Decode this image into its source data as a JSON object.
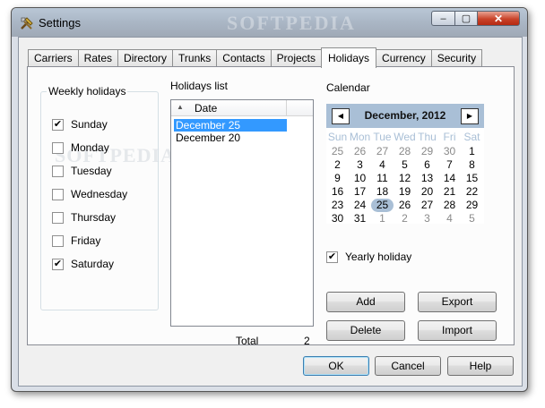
{
  "window": {
    "title": "Settings",
    "watermark": "SOFTPEDIA"
  },
  "titlebar_buttons": {
    "minimize": "–",
    "maximize": "▢",
    "close": "✕"
  },
  "tabs": [
    "Carriers",
    "Rates",
    "Directory",
    "Trunks",
    "Contacts",
    "Projects",
    "Holidays",
    "Currency",
    "Security"
  ],
  "active_tab": "Holidays",
  "weekly": {
    "title": "Weekly holidays",
    "days": [
      {
        "label": "Sunday",
        "checked": true
      },
      {
        "label": "Monday",
        "checked": false
      },
      {
        "label": "Tuesday",
        "checked": false
      },
      {
        "label": "Wednesday",
        "checked": false
      },
      {
        "label": "Thursday",
        "checked": false
      },
      {
        "label": "Friday",
        "checked": false
      },
      {
        "label": "Saturday",
        "checked": true
      }
    ]
  },
  "holidays": {
    "title": "Holidays list",
    "column": "Date",
    "items": [
      "December 25",
      "December 20"
    ],
    "selected_index": 0,
    "total_label": "Total",
    "total_value": "2"
  },
  "calendar": {
    "title": "Calendar",
    "month": "December, 2012",
    "dow": [
      "Sun",
      "Mon",
      "Tue",
      "Wed",
      "Thu",
      "Fri",
      "Sat"
    ],
    "weeks": [
      [
        "25",
        "26",
        "27",
        "28",
        "29",
        "30",
        "1"
      ],
      [
        "2",
        "3",
        "4",
        "5",
        "6",
        "7",
        "8"
      ],
      [
        "9",
        "10",
        "11",
        "12",
        "13",
        "14",
        "15"
      ],
      [
        "16",
        "17",
        "18",
        "19",
        "20",
        "21",
        "22"
      ],
      [
        "23",
        "24",
        "25",
        "26",
        "27",
        "28",
        "29"
      ],
      [
        "30",
        "31",
        "1",
        "2",
        "3",
        "4",
        "5"
      ]
    ],
    "other_month": [
      [
        0,
        0
      ],
      [
        0,
        1
      ],
      [
        0,
        2
      ],
      [
        0,
        3
      ],
      [
        0,
        4
      ],
      [
        0,
        5
      ],
      [
        5,
        2
      ],
      [
        5,
        3
      ],
      [
        5,
        4
      ],
      [
        5,
        5
      ],
      [
        5,
        6
      ]
    ],
    "highlighted": [
      4,
      2
    ],
    "header_color": "#a9bfd6"
  },
  "yearly": {
    "label": "Yearly holiday",
    "checked": true
  },
  "buttons": {
    "add": "Add",
    "export": "Export",
    "delete": "Delete",
    "import": "Import",
    "ok": "OK",
    "cancel": "Cancel",
    "help": "Help"
  }
}
